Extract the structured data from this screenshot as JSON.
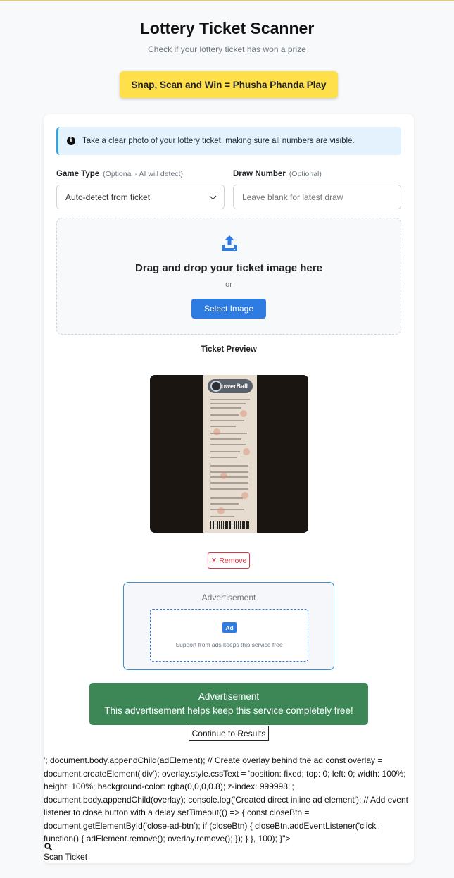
{
  "header": {
    "title": "Lottery Ticket Scanner",
    "subtitle": "Check if your lottery ticket has won a prize",
    "promo": "Snap, Scan and Win = Phusha Phanda Play"
  },
  "form": {
    "info_text": "Take a clear photo of your lottery ticket, making sure all numbers are visible.",
    "game_type_label": "Game Type",
    "game_type_optional": "(Optional - AI will detect)",
    "game_type_value": "Auto-detect from ticket",
    "draw_label": "Draw Number",
    "draw_optional": "(Optional)",
    "draw_placeholder": "Leave blank for latest draw"
  },
  "upload": {
    "title": "Drag and drop your ticket image here",
    "or": "or",
    "button": "Select Image"
  },
  "preview": {
    "title": "Ticket Preview",
    "ticket_logo": "PowerBall",
    "remove": "✕ Remove"
  },
  "ads": {
    "box_label": "Advertisement",
    "badge": "Ad",
    "support": "Support from ads keeps this service free",
    "green_title": "Advertisement",
    "green_text": "This advertisement helps keep this service completely free!",
    "continue": "Continue to Results"
  },
  "leaked_code": "'; document.body.appendChild(adElement); // Create overlay behind the ad const overlay = document.createElement('div'); overlay.style.cssText = 'position: fixed; top: 0; left: 0; width: 100%; height: 100%; background-color: rgba(0,0,0,0.8); z-index: 999998;'; document.body.appendChild(overlay); console.log('Created direct inline ad element'); // Add event listener to close button with a delay setTimeout(() => { const closeBtn = document.getElementById('close-ad-btn'); if (closeBtn) { closeBtn.addEventListener('click', function() { adElement.remove(); overlay.remove(); }); } }, 100); }\">",
  "scan_label": "Scan Ticket",
  "colors": {
    "accent_blue": "#2e7be2",
    "promo_yellow": "#ffdf4a",
    "ad_green": "#3d8757",
    "danger": "#dc3545"
  }
}
